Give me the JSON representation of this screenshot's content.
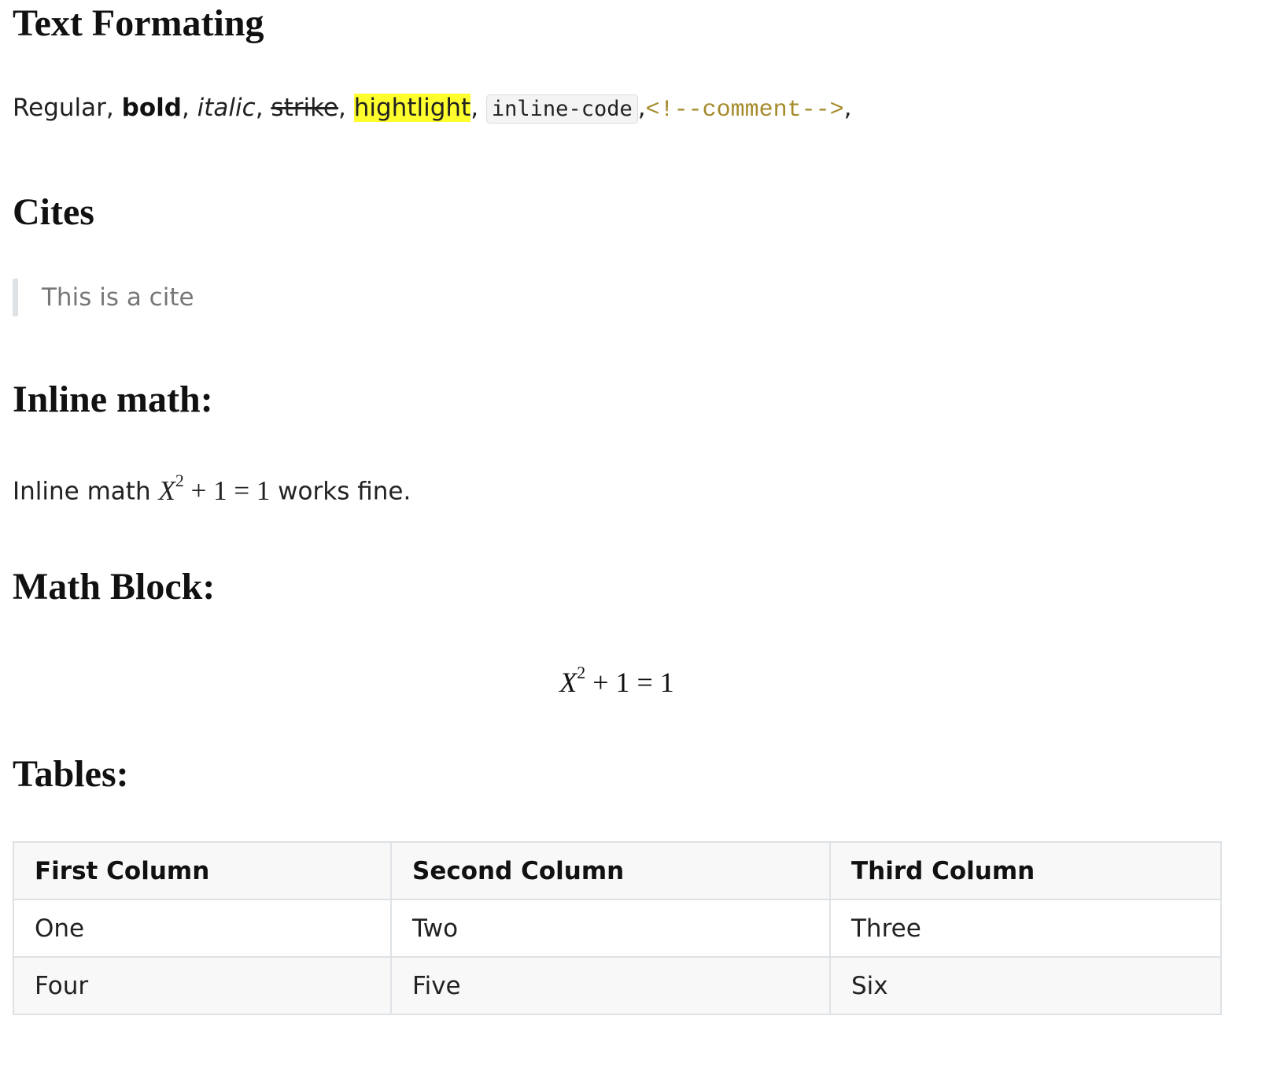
{
  "headings": {
    "text_formatting": "Text Formating",
    "cites": "Cites",
    "inline_math": "Inline math:",
    "math_block": "Math Block:",
    "tables": "Tables:"
  },
  "formatting": {
    "regular": "Regular",
    "bold": "bold",
    "italic": "italic",
    "strike": "strike",
    "highlight": "hightlight",
    "code": "inline-code",
    "comment": "<!--comment-->",
    "sep": ", ",
    "trailing": ","
  },
  "cite": {
    "text": "This is a cite"
  },
  "inline_math": {
    "prefix": "Inline math ",
    "var": "X",
    "exp": "2",
    "rest": " + 1 = 1",
    "suffix": " works fine."
  },
  "math_block": {
    "var": "X",
    "exp": "2",
    "rest": " + 1 = 1"
  },
  "table": {
    "headers": [
      "First Column",
      "Second Column",
      "Third Column"
    ],
    "rows": [
      [
        "One",
        "Two",
        "Three"
      ],
      [
        "Four",
        "Five",
        "Six"
      ]
    ]
  },
  "colors": {
    "highlight": "#ffff2e",
    "comment": "#a68b2c",
    "cite_bar": "#dfe2e5"
  }
}
